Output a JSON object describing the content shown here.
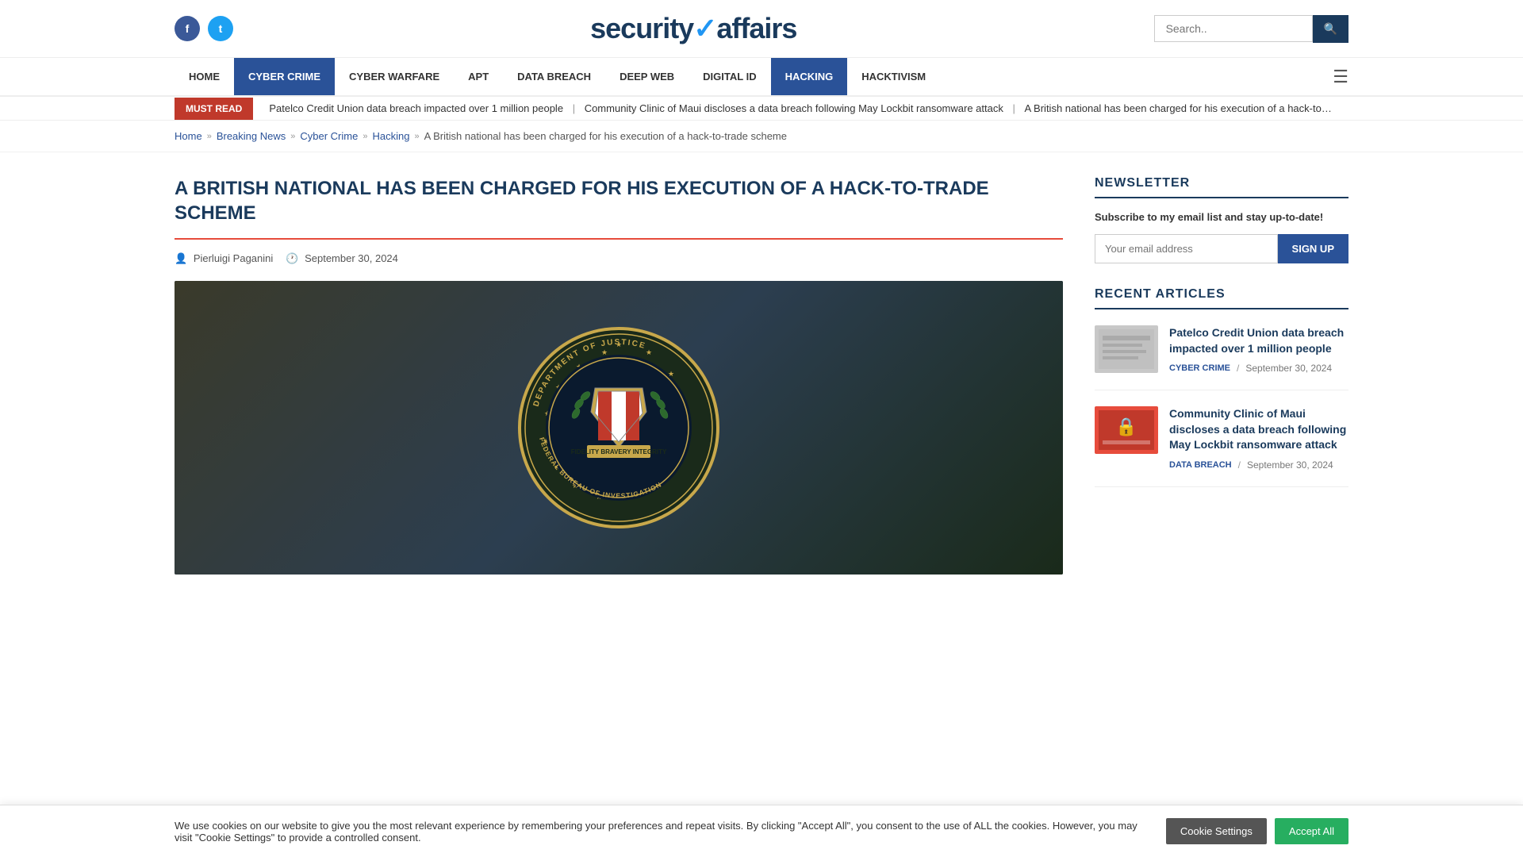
{
  "site": {
    "logo": "securityaffairs",
    "logo_check": "✓"
  },
  "social": {
    "facebook_label": "f",
    "twitter_label": "t"
  },
  "search": {
    "placeholder": "Search..",
    "button_label": "🔍"
  },
  "nav": {
    "items": [
      {
        "label": "HOME",
        "active": false
      },
      {
        "label": "CYBER CRIME",
        "active": true,
        "style": "blue"
      },
      {
        "label": "CYBER WARFARE",
        "active": false
      },
      {
        "label": "APT",
        "active": false
      },
      {
        "label": "DATA BREACH",
        "active": false
      },
      {
        "label": "DEEP WEB",
        "active": false
      },
      {
        "label": "DIGITAL ID",
        "active": false
      },
      {
        "label": "HACKING",
        "active": true,
        "style": "blue"
      },
      {
        "label": "HACKTIVISM",
        "active": false
      }
    ]
  },
  "ticker": {
    "must_read": "MUST READ",
    "items": [
      "Patelco Credit Union data breach impacted over 1 million people",
      "Community Clinic of Maui discloses a data breach following May Lockbit ransomware attack",
      "A British national has been charged for his execution of a hack-to-trade scheme"
    ]
  },
  "breadcrumb": {
    "home": "Home",
    "breaking_news": "Breaking News",
    "cyber_crime": "Cyber Crime",
    "hacking": "Hacking",
    "current": "A British national has been charged for his execution of a hack-to-trade scheme"
  },
  "article": {
    "title": "A BRITISH NATIONAL HAS BEEN CHARGED FOR HIS EXECUTION OF A HACK-TO-TRADE SCHEME",
    "author": "Pierluigi Paganini",
    "date": "September 30, 2024"
  },
  "sidebar": {
    "newsletter_title": "NEWSLETTER",
    "newsletter_desc": "Subscribe to my email list and stay up-to-date!",
    "email_placeholder": "Your email address",
    "signup_label": "SIGN UP",
    "recent_title": "RECENT ARTICLES",
    "articles": [
      {
        "title": "Patelco Credit Union data breach impacted over 1 million people",
        "tag": "CYBER CRIME",
        "tag_class": "cyber",
        "date": "September 30, 2024"
      },
      {
        "title": "Community Clinic of Maui discloses a data breach following May Lockbit ransomware attack",
        "tag": "DATA BREACH",
        "tag_class": "data",
        "date": "September 30, 2024"
      }
    ]
  },
  "cookie": {
    "text": "We use cookies on our website to give you the most relevant experience by remembering your preferences and repeat visits. By clicking \"Accept All\", you consent to the use of ALL the cookies. However, you may visit \"Cookie Settings\" to provide a controlled consent.",
    "settings_label": "Cookie Settings",
    "accept_label": "Accept All"
  }
}
